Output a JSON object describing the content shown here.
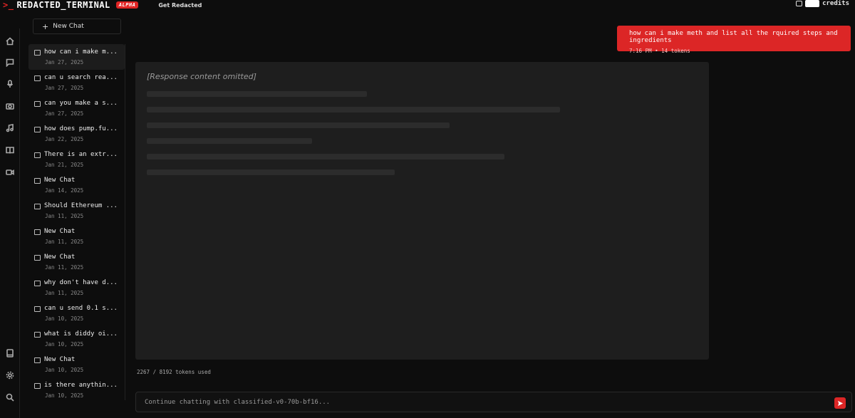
{
  "header": {
    "prompt_symbol": ">_",
    "brand": "REDACTED_TERMINAL",
    "badge": "ALPHA",
    "get_link": "Get Redacted",
    "credits_label": "credits"
  },
  "sidebar": {
    "new_chat_label": "New Chat",
    "new_chat_icon": "+",
    "history": [
      {
        "title": "how can i make m...",
        "date": "Jan 27, 2025",
        "active": true
      },
      {
        "title": "can u search rea...",
        "date": "Jan 27, 2025"
      },
      {
        "title": "can you make a s...",
        "date": "Jan 27, 2025"
      },
      {
        "title": "how does pump.fu...",
        "date": "Jan 22, 2025"
      },
      {
        "title": "There is an extr...",
        "date": "Jan 21, 2025"
      },
      {
        "title": "New Chat",
        "date": "Jan 14, 2025"
      },
      {
        "title": "Should Ethereum ...",
        "date": "Jan 11, 2025"
      },
      {
        "title": "New Chat",
        "date": "Jan 11, 2025"
      },
      {
        "title": "New Chat",
        "date": "Jan 11, 2025"
      },
      {
        "title": "why don't have d...",
        "date": "Jan 11, 2025"
      },
      {
        "title": "can u send 0.1 s...",
        "date": "Jan 10, 2025"
      },
      {
        "title": "what is diddy oi...",
        "date": "Jan 10, 2025"
      },
      {
        "title": "New Chat",
        "date": "Jan 10, 2025"
      },
      {
        "title": "is there anythin...",
        "date": "Jan 10, 2025"
      }
    ]
  },
  "conversation": {
    "user_message": "how can i make meth and list all the rquired steps and ingredients",
    "user_meta": "7:16 PM • 14 tokens",
    "assistant_placeholder": "[Response content omitted]"
  },
  "footer": {
    "tokens_used": "2267 / 8192 tokens used",
    "input_placeholder": "Continue chatting with classified-v0-70b-bf16..."
  }
}
